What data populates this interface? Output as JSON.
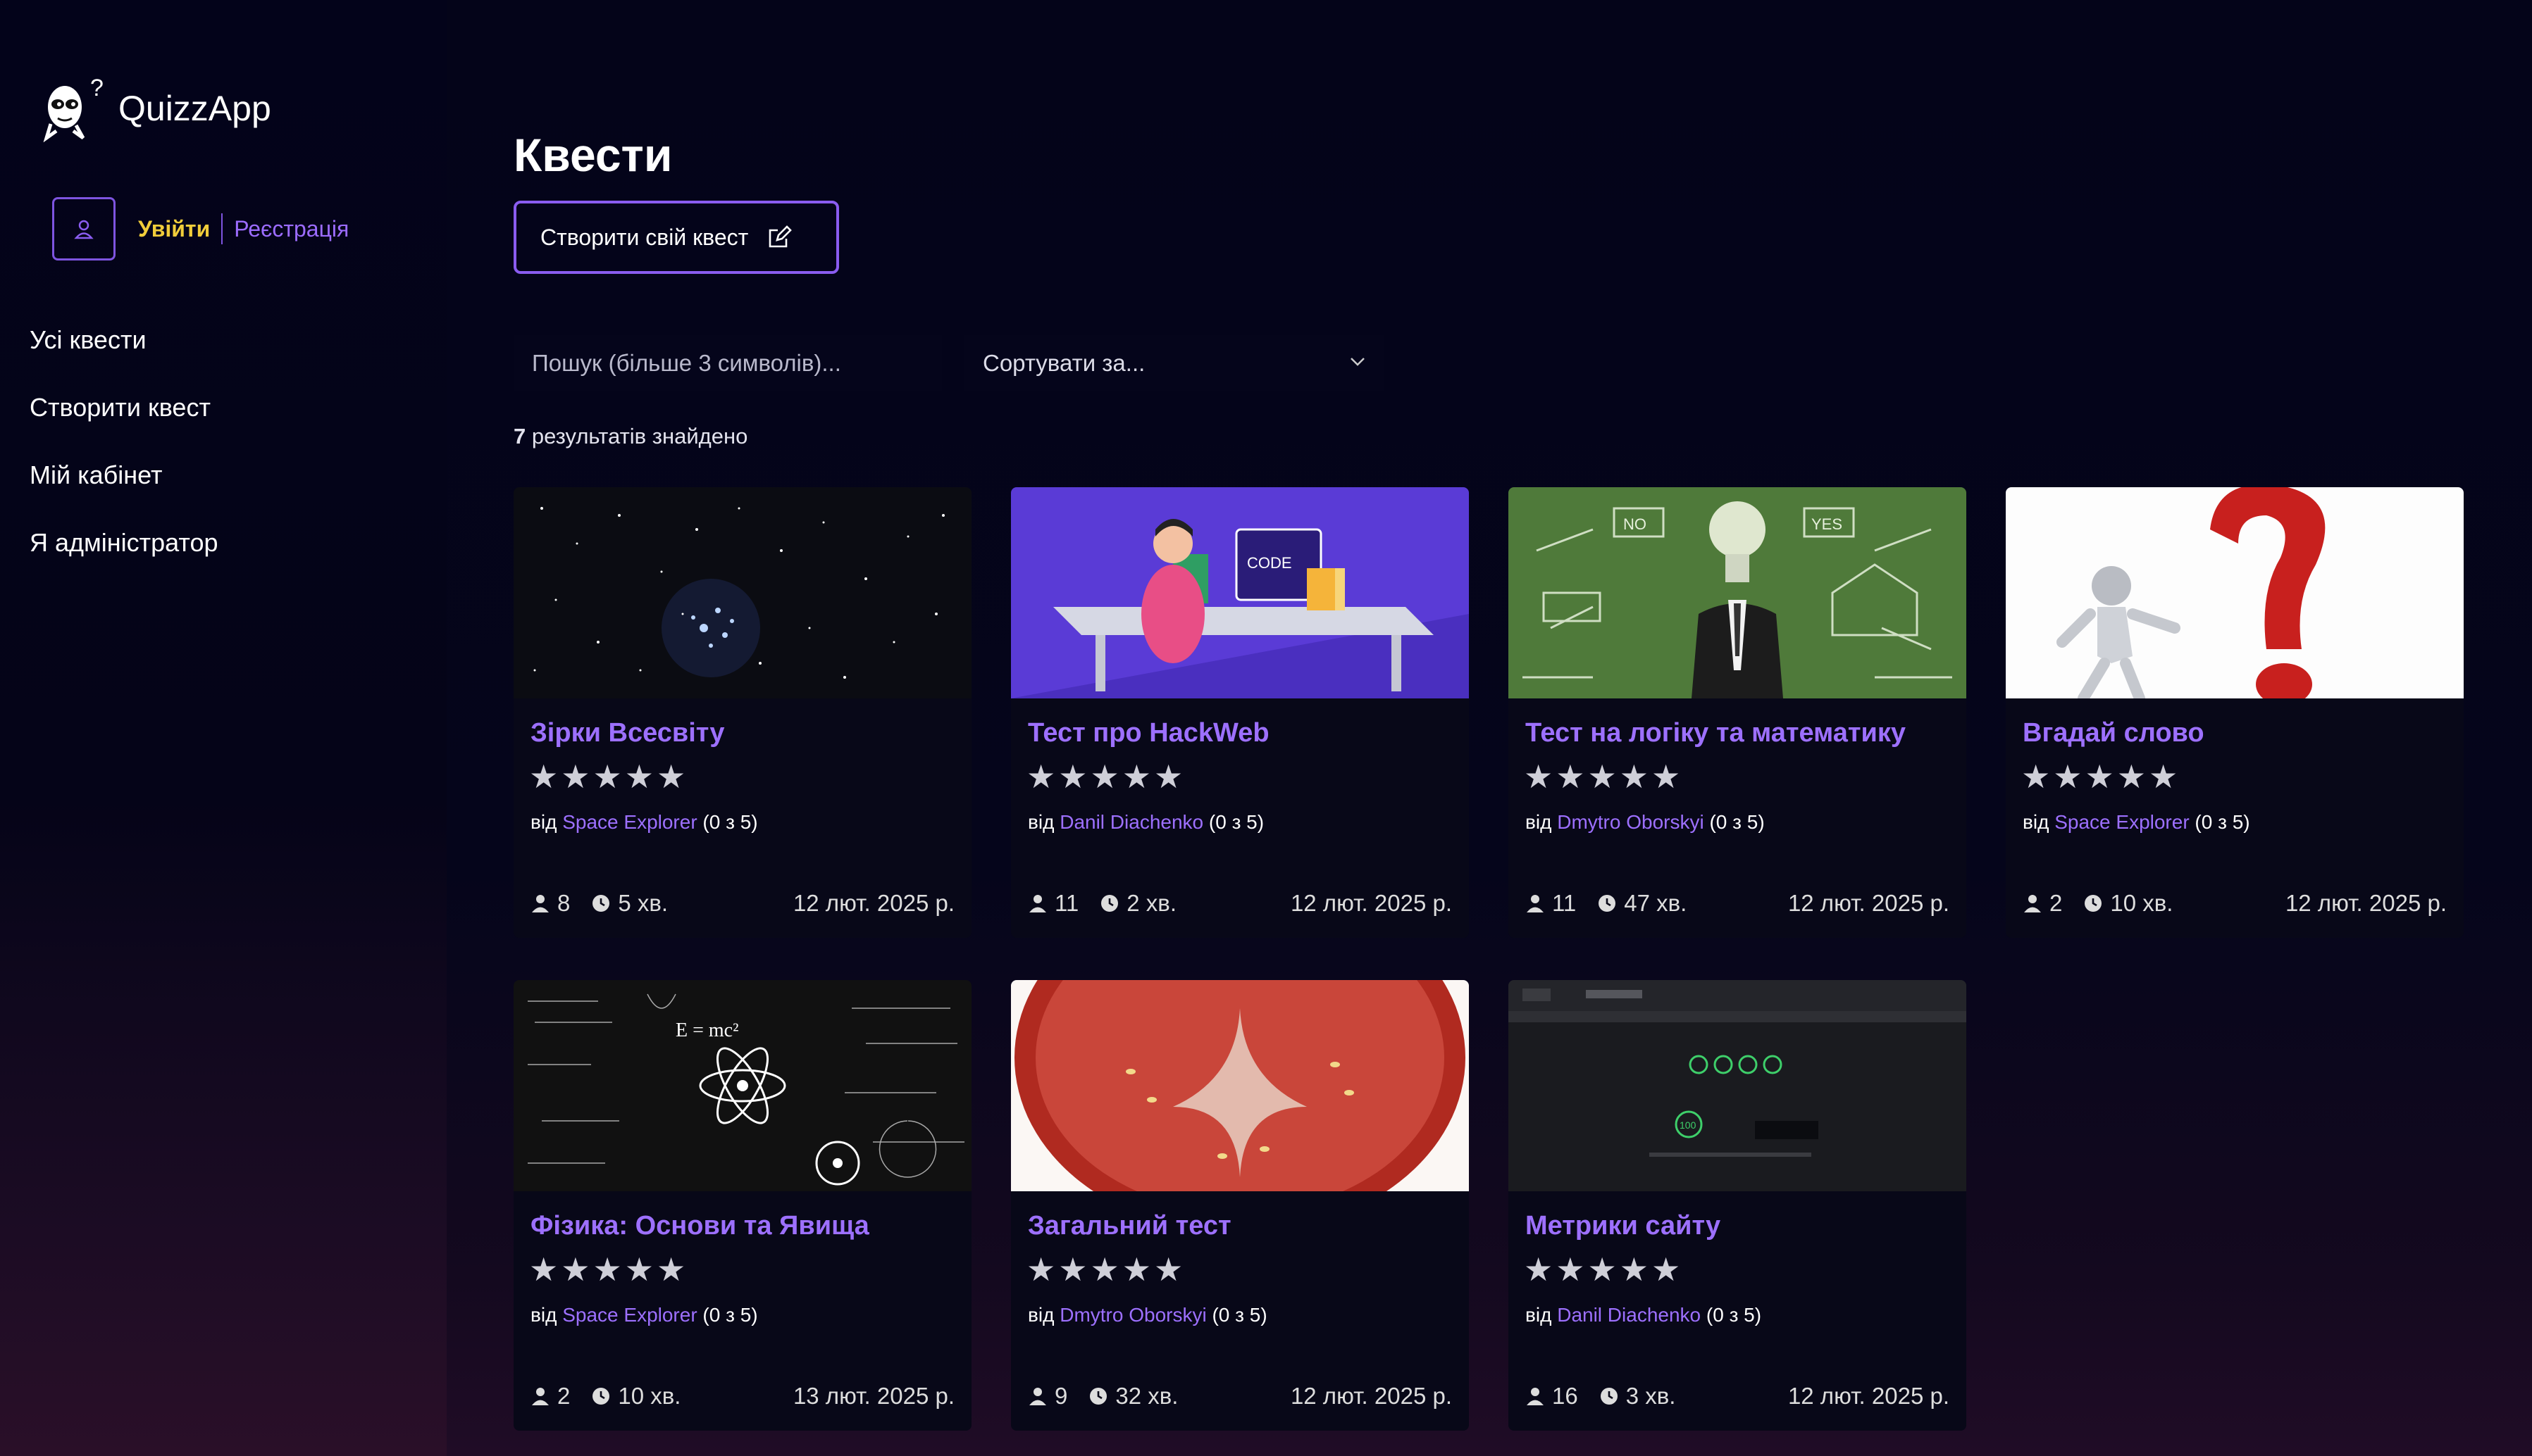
{
  "app": {
    "name": "QuizzApp"
  },
  "auth": {
    "login": "Увійти",
    "register": "Реєстрація"
  },
  "nav": [
    "Усі квести",
    "Створити квест",
    "Мій кабінет",
    "Я адміністратор"
  ],
  "page": {
    "title": "Квести",
    "create_button": "Створити свій квест"
  },
  "filters": {
    "search_placeholder": "Пошук (більше 3 символів)...",
    "sort_label": "Сортувати за..."
  },
  "results": {
    "count": "7",
    "text": " результатів знайдено"
  },
  "cards": [
    {
      "title": "Зірки Всесвіту",
      "by": "від ",
      "author": "Space Explorer",
      "rating": " (0 з 5)",
      "players": "8",
      "time": "5 хв.",
      "date": "12 лют. 2025 р."
    },
    {
      "title": "Тест про HackWeb",
      "by": "від ",
      "author": "Danil Diachenko",
      "rating": " (0 з 5)",
      "players": "11",
      "time": "2 хв.",
      "date": "12 лют. 2025 р.",
      "image_text": "CODE"
    },
    {
      "title": "Тест на логіку та математику",
      "by": "від ",
      "author": "Dmytro Oborskyi",
      "rating": " (0 з 5)",
      "players": "11",
      "time": "47 хв.",
      "date": "12 лют. 2025 р.",
      "image_text_1": "NO",
      "image_text_2": "YES"
    },
    {
      "title": "Вгадай слово",
      "by": "від ",
      "author": "Space Explorer",
      "rating": " (0 з 5)",
      "players": "2",
      "time": "10 хв.",
      "date": "12 лют. 2025 р."
    },
    {
      "title": "Фізика: Основи та Явища",
      "by": "від ",
      "author": "Space Explorer",
      "rating": " (0 з 5)",
      "players": "2",
      "time": "10 хв.",
      "date": "13 лют. 2025 р.",
      "image_text": "E = mc²"
    },
    {
      "title": "Загальний тест",
      "by": "від ",
      "author": "Dmytro Oborskyi",
      "rating": " (0 з 5)",
      "players": "9",
      "time": "32 хв.",
      "date": "12 лют. 2025 р."
    },
    {
      "title": "Метрики сайту",
      "by": "від ",
      "author": "Danil Diachenko",
      "rating": " (0 з 5)",
      "players": "16",
      "time": "3 хв.",
      "date": "12 лют. 2025 р.",
      "image_text": "100"
    }
  ],
  "stars": "★★★★★",
  "colors": {
    "accent": "#9d70ff",
    "login": "#f1cd3a",
    "border": "#8a5cf0",
    "background": "#04041a"
  }
}
